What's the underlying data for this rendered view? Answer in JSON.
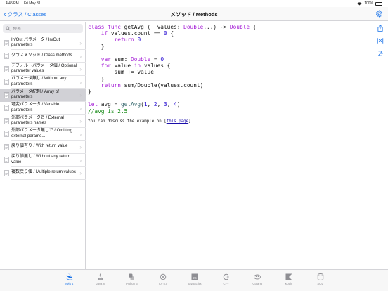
{
  "status_bar": {
    "time": "4:45 PM",
    "date": "Fri May 31",
    "battery": "100%"
  },
  "nav": {
    "back_label": "クラス / Classes",
    "title": "メソッド / Methods"
  },
  "search": {
    "placeholder": "検索"
  },
  "topics": [
    {
      "label": "In/Out パラメータ / In/Out parameters",
      "selected": false
    },
    {
      "label": "クラスメソッド / Class methods",
      "selected": false
    },
    {
      "label": "デフォルトパラメータ値 / Optional parameter values",
      "selected": false
    },
    {
      "label": "パラメータ無し / Without any parameters",
      "selected": false
    },
    {
      "label": "パラメータ配列 / Array of parameters",
      "selected": true
    },
    {
      "label": "可変パラメータ / Variable parameters",
      "selected": false
    },
    {
      "label": "外部パラメータ名 / External parameters names",
      "selected": false
    },
    {
      "label": "外部パラメータ無しで / Omitting external parame...",
      "selected": false
    },
    {
      "label": "戻り値有り / With return value",
      "selected": false
    },
    {
      "label": "戻り値無し / Without any return value",
      "selected": false
    },
    {
      "label": "複数戻り値 / Multiple return values",
      "selected": false
    }
  ],
  "code": {
    "l1_kw": "class func",
    "l1_a": " getAvg (_ values: ",
    "l1_type": "Double",
    "l1_b": "...) -> ",
    "l1_type2": "Double",
    "l1_c": " {",
    "l2_ind": "    ",
    "l2_kw": "if",
    "l2_a": " values.count == ",
    "l2_num": "0",
    "l2_b": " {",
    "l3_ind": "        ",
    "l3_kw": "return",
    "l3_sp": " ",
    "l3_num": "0",
    "l4": "    }",
    "l6_ind": "    ",
    "l6_kw": "var",
    "l6_a": " sum: ",
    "l6_type": "Double",
    "l6_b": " = ",
    "l6_num": "0",
    "l7_ind": "    ",
    "l7_kw": "for",
    "l7_a": " value ",
    "l7_kw2": "in",
    "l7_b": " values {",
    "l8": "        sum += value",
    "l9": "    }",
    "l10_ind": "    ",
    "l10_kw": "return",
    "l10_a": " sum/Double(values.count)",
    "l11": "}",
    "l13_kw": "let",
    "l13_a": " avg = ",
    "l13_call": "getAvg",
    "l13_b": "(",
    "l13_n1": "1",
    "l13_c1": ", ",
    "l13_n2": "2",
    "l13_c2": ", ",
    "l13_n3": "3",
    "l13_c3": ", ",
    "l13_n4": "4",
    "l13_d": ")",
    "l14": "//avg is 2.5"
  },
  "discuss": {
    "prefix": "You can discuss the example on ",
    "link_open": "[",
    "link": "this page",
    "link_close": "]"
  },
  "tabs": [
    {
      "label": "Swift 4",
      "icon": "swift-icon",
      "active": true
    },
    {
      "label": "Java 8",
      "icon": "java-icon",
      "active": false
    },
    {
      "label": "Python 3",
      "icon": "python-icon",
      "active": false
    },
    {
      "label": "C# 5.0",
      "icon": "csharp-icon",
      "active": false
    },
    {
      "label": "JavaScript",
      "icon": "javascript-icon",
      "active": false
    },
    {
      "label": "C++",
      "icon": "cpp-icon",
      "active": false
    },
    {
      "label": "Golang",
      "icon": "golang-icon",
      "active": false
    },
    {
      "label": "Kotlin",
      "icon": "kotlin-icon",
      "active": false
    },
    {
      "label": "SQL",
      "icon": "sql-icon",
      "active": false
    }
  ],
  "colors": {
    "accent": "#1a73e8",
    "keyword": "#a51ed6",
    "number": "#1c00cf",
    "comment": "#118811"
  }
}
